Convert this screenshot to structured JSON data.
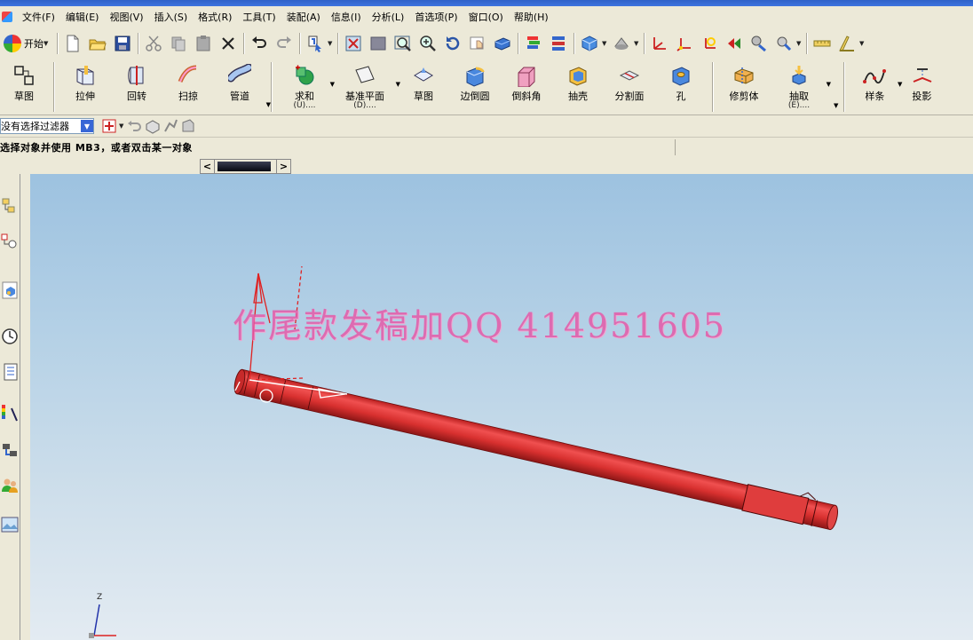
{
  "menubar": {
    "items": [
      "文件(F)",
      "编辑(E)",
      "视图(V)",
      "插入(S)",
      "格式(R)",
      "工具(T)",
      "装配(A)",
      "信息(I)",
      "分析(L)",
      "首选项(P)",
      "窗口(O)",
      "帮助(H)"
    ]
  },
  "toolbar1": {
    "start_label": "开始",
    "icons": [
      "new-icon",
      "open-icon",
      "save-icon",
      "cut-icon",
      "copy-icon",
      "paste-icon",
      "delete-icon",
      "undo-icon",
      "redo-icon",
      "selection-icon",
      "fit-icon",
      "zoom-region-icon",
      "zoom-icon",
      "zoom-in-icon",
      "rotate-icon",
      "pan-icon",
      "shaded-view-icon",
      "layer-icon",
      "layer-settings-icon",
      "view-cube-icon",
      "render-style-icon",
      "wcs-icon",
      "wcs-origin-icon",
      "wcs-rotate-icon",
      "wcs-orient-icon",
      "analysis-icon",
      "measure-distance-icon",
      "measure-angle-icon"
    ]
  },
  "toolbar2": {
    "buttons": [
      {
        "label": "草图",
        "sub": ""
      },
      {
        "label": "拉伸",
        "sub": ""
      },
      {
        "label": "回转",
        "sub": ""
      },
      {
        "label": "扫掠",
        "sub": ""
      },
      {
        "label": "管道",
        "sub": ""
      },
      {
        "label": "求和",
        "sub": "(U)...."
      },
      {
        "label": "基准平面",
        "sub": "(D)...."
      },
      {
        "label": "草图",
        "sub": ""
      },
      {
        "label": "边倒圆",
        "sub": ""
      },
      {
        "label": "倒斜角",
        "sub": ""
      },
      {
        "label": "抽壳",
        "sub": ""
      },
      {
        "label": "分割面",
        "sub": ""
      },
      {
        "label": "孔",
        "sub": ""
      },
      {
        "label": "修剪体",
        "sub": ""
      },
      {
        "label": "抽取",
        "sub": "(E)...."
      },
      {
        "label": "样条",
        "sub": ""
      },
      {
        "label": "投影",
        "sub": ""
      }
    ]
  },
  "filterbar": {
    "filter_value": "没有选择过滤器"
  },
  "status": {
    "prompt": "选择对象并使用 MB3，或者双击某一对象"
  },
  "viewport": {
    "watermark": "作尾款发稿加QQ 414951605",
    "axis_z_label": "Z",
    "model_color": "#e0393a",
    "csys_color": "#e02020"
  },
  "leftpanel": {
    "icons": [
      "assembly-navigator-icon",
      "constraint-navigator-icon",
      "part-navigator-icon",
      "history-icon",
      "reuse-library-icon",
      "palette-icon",
      "process-studio-icon",
      "roles-icon",
      "system-scenes-icon"
    ]
  }
}
